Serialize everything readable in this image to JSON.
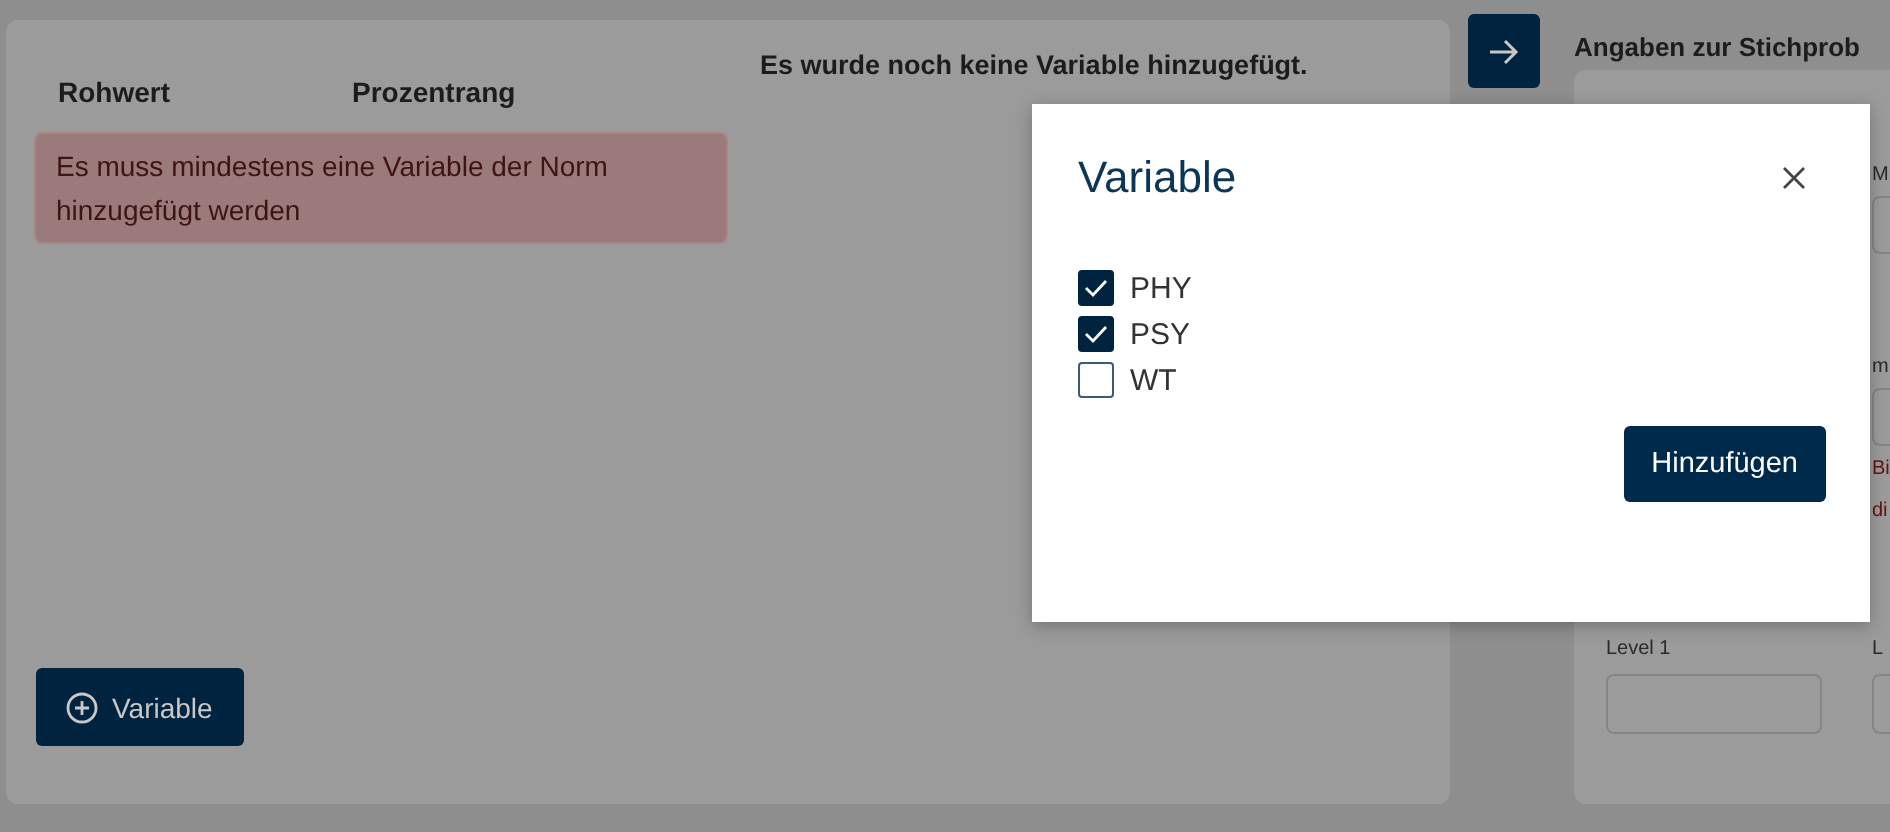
{
  "left_panel": {
    "columns": [
      "Rohwert",
      "Prozentrang"
    ],
    "empty_message": "Es wurde noch keine Variable hinzugefügt.",
    "error": "Es muss mindestens eine Variable der Norm hinzugefügt werden",
    "add_button": "Variable"
  },
  "right_panel": {
    "title": "Angaben zur Stichprob",
    "fields": [
      {
        "label": "M"
      },
      {
        "label": "m",
        "error_lines": [
          "Bi",
          "di"
        ]
      }
    ],
    "level_fields": [
      {
        "label": "Level 1"
      },
      {
        "label": "L"
      }
    ]
  },
  "dialog": {
    "title": "Variable",
    "options": [
      {
        "label": "PHY",
        "checked": true
      },
      {
        "label": "PSY",
        "checked": true
      },
      {
        "label": "WT",
        "checked": false
      }
    ],
    "button": "Hinzufügen"
  }
}
